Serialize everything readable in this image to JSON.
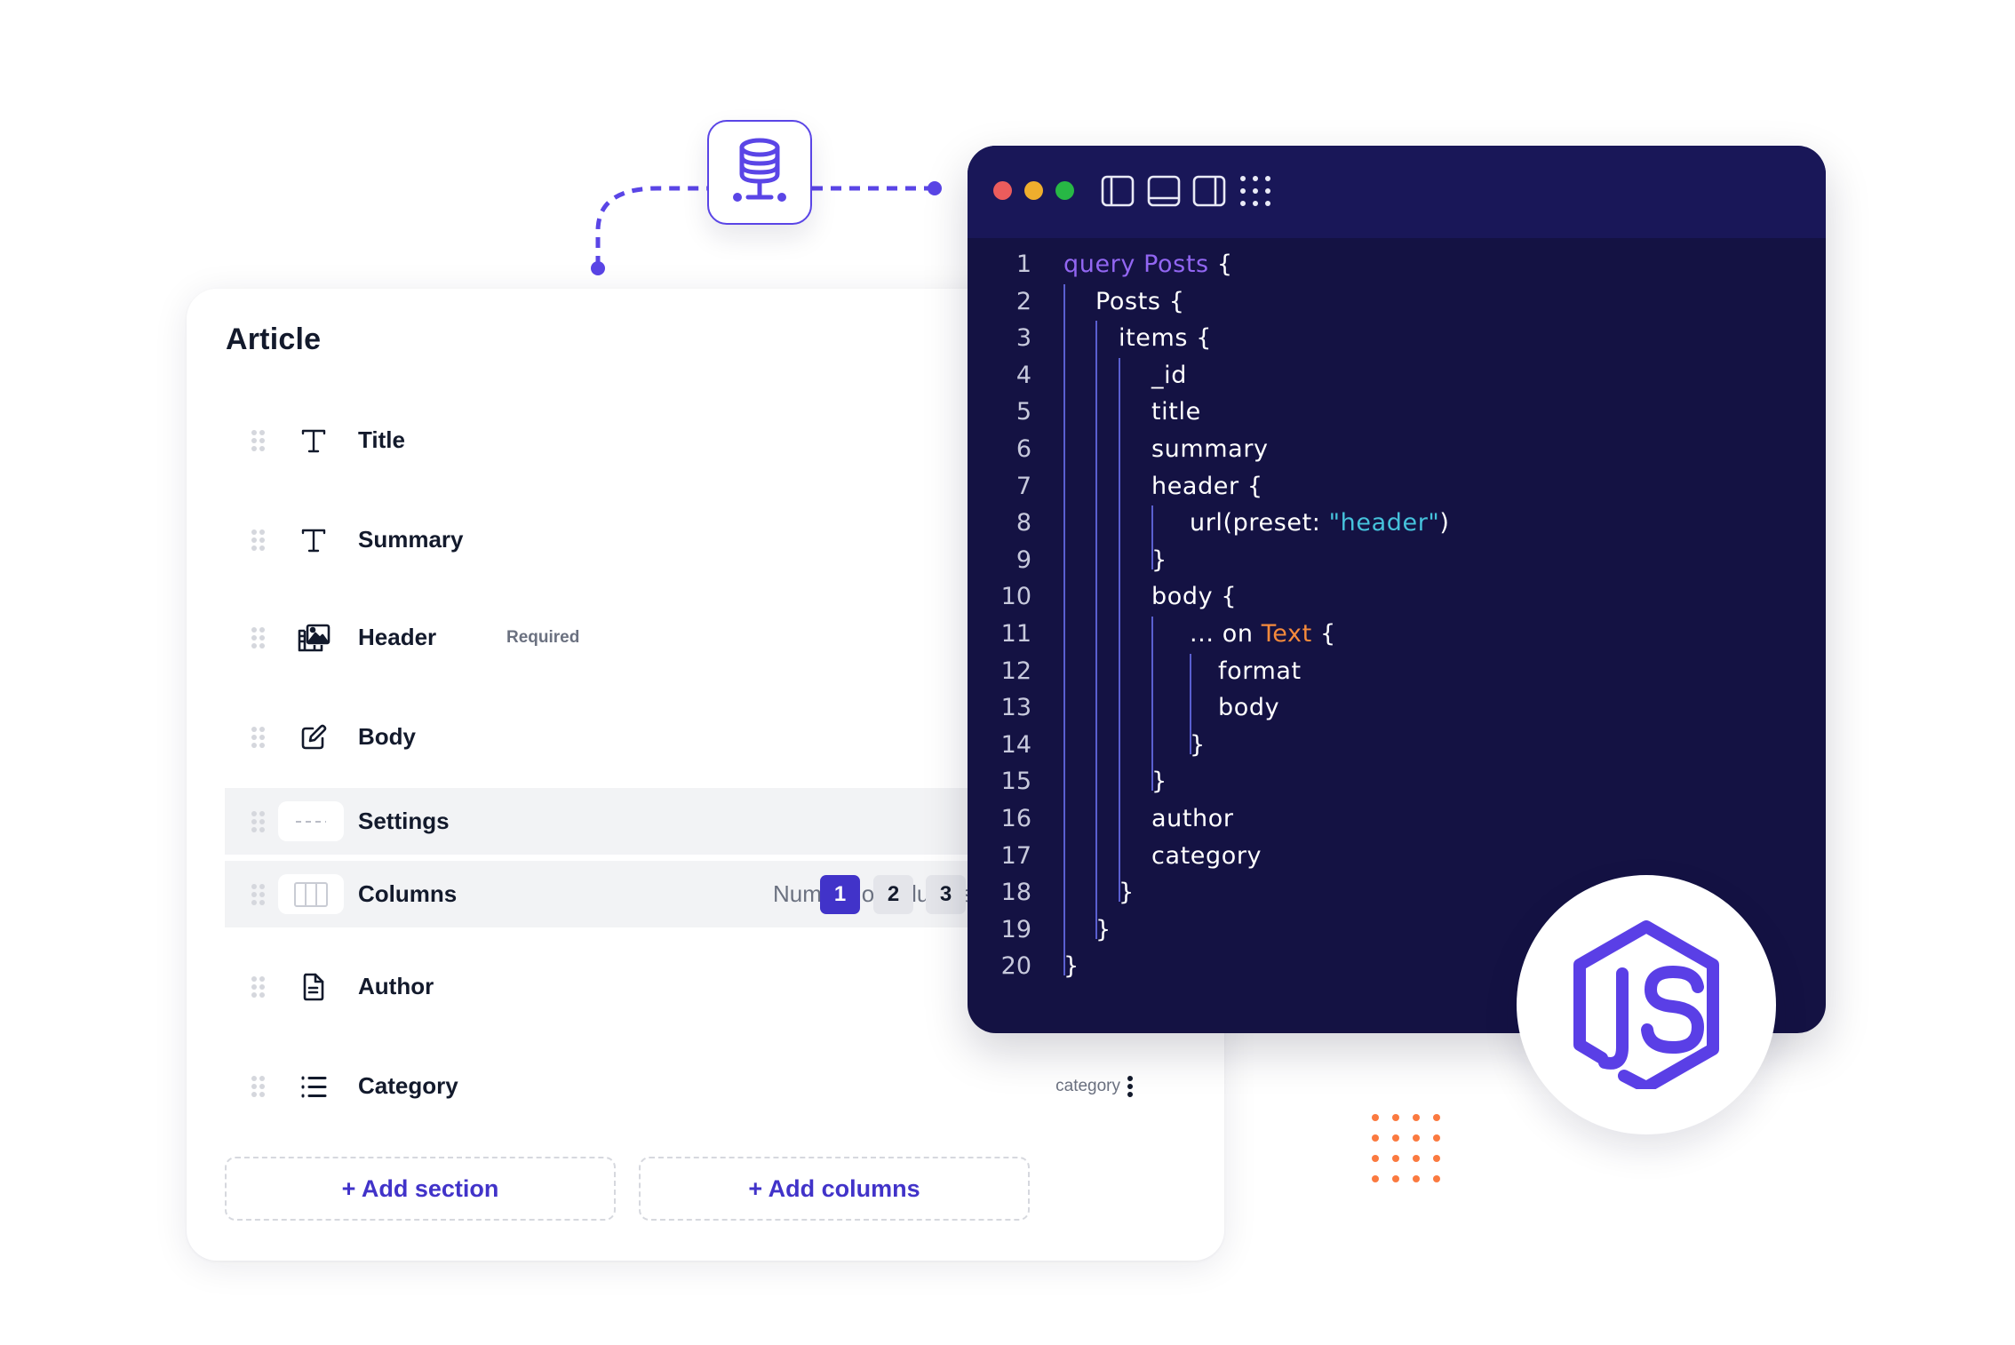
{
  "connector": {
    "icon": "database-icon",
    "accent": "#5a45e6"
  },
  "article_card": {
    "title": "Article",
    "fields": [
      {
        "label": "Title",
        "icon": "text-type-icon"
      },
      {
        "label": "Summary",
        "icon": "text-type-icon"
      },
      {
        "label": "Header",
        "icon": "image-gallery-icon",
        "badge": "Required"
      },
      {
        "label": "Body",
        "icon": "edit-pencil-icon"
      },
      {
        "label": "Settings",
        "icon": "divider-icon"
      },
      {
        "label": "Columns",
        "icon": "columns-icon",
        "number_of_columns_label": "Number of columns:",
        "column_options": [
          "1",
          "2",
          "3"
        ],
        "selected_columns": "1"
      },
      {
        "label": "Author",
        "icon": "document-icon"
      },
      {
        "label": "Category",
        "icon": "list-icon",
        "slug": "category"
      }
    ],
    "add_section_label": "+ Add section",
    "add_columns_label": "+ Add columns"
  },
  "code_window": {
    "traffic_lights": [
      "#eb5c5c",
      "#efae2d",
      "#27b845"
    ],
    "toolbar_icons": [
      "sidebar-left-icon",
      "panel-bottom-icon",
      "sidebar-right-icon",
      "grid-dots-icon"
    ],
    "lines": [
      {
        "n": "1",
        "parts": [
          {
            "t": "query Posts",
            "c": "kw"
          },
          {
            "t": " {"
          }
        ]
      },
      {
        "n": "2",
        "parts": [
          {
            "t": "Posts {"
          }
        ]
      },
      {
        "n": "3",
        "parts": [
          {
            "t": "items {"
          }
        ]
      },
      {
        "n": "4",
        "parts": [
          {
            "t": "_id"
          }
        ]
      },
      {
        "n": "5",
        "parts": [
          {
            "t": "title"
          }
        ]
      },
      {
        "n": "6",
        "parts": [
          {
            "t": "summary"
          }
        ]
      },
      {
        "n": "7",
        "parts": [
          {
            "t": "header {"
          }
        ]
      },
      {
        "n": "8",
        "parts": [
          {
            "t": "url(preset: "
          },
          {
            "t": "\"header\"",
            "c": "str"
          },
          {
            "t": ")"
          }
        ]
      },
      {
        "n": "9",
        "parts": [
          {
            "t": "}"
          }
        ]
      },
      {
        "n": "10",
        "parts": [
          {
            "t": "body {"
          }
        ]
      },
      {
        "n": "11",
        "parts": [
          {
            "t": "... on "
          },
          {
            "t": "Text",
            "c": "typ"
          },
          {
            "t": " {"
          }
        ]
      },
      {
        "n": "12",
        "parts": [
          {
            "t": "format"
          }
        ]
      },
      {
        "n": "13",
        "parts": [
          {
            "t": "body"
          }
        ]
      },
      {
        "n": "14",
        "parts": [
          {
            "t": "}"
          }
        ]
      },
      {
        "n": "15",
        "parts": [
          {
            "t": "}"
          }
        ]
      },
      {
        "n": "16",
        "parts": [
          {
            "t": "author"
          }
        ]
      },
      {
        "n": "17",
        "parts": [
          {
            "t": "category"
          }
        ]
      },
      {
        "n": "18",
        "parts": [
          {
            "t": "}"
          }
        ]
      },
      {
        "n": "19",
        "parts": [
          {
            "t": "}"
          }
        ]
      },
      {
        "n": "20",
        "parts": [
          {
            "t": "}"
          }
        ]
      }
    ],
    "colors": {
      "keyword": "#9266f2",
      "string": "#46c3dc",
      "type": "#f58a3c",
      "background": "#141243",
      "titlebar": "#191758"
    }
  },
  "js_badge": {
    "label": "JS",
    "icon": "nodejs-hexagon-icon",
    "color": "#5a3fe6"
  },
  "decor": {
    "dots_color": "#fb7a40"
  }
}
